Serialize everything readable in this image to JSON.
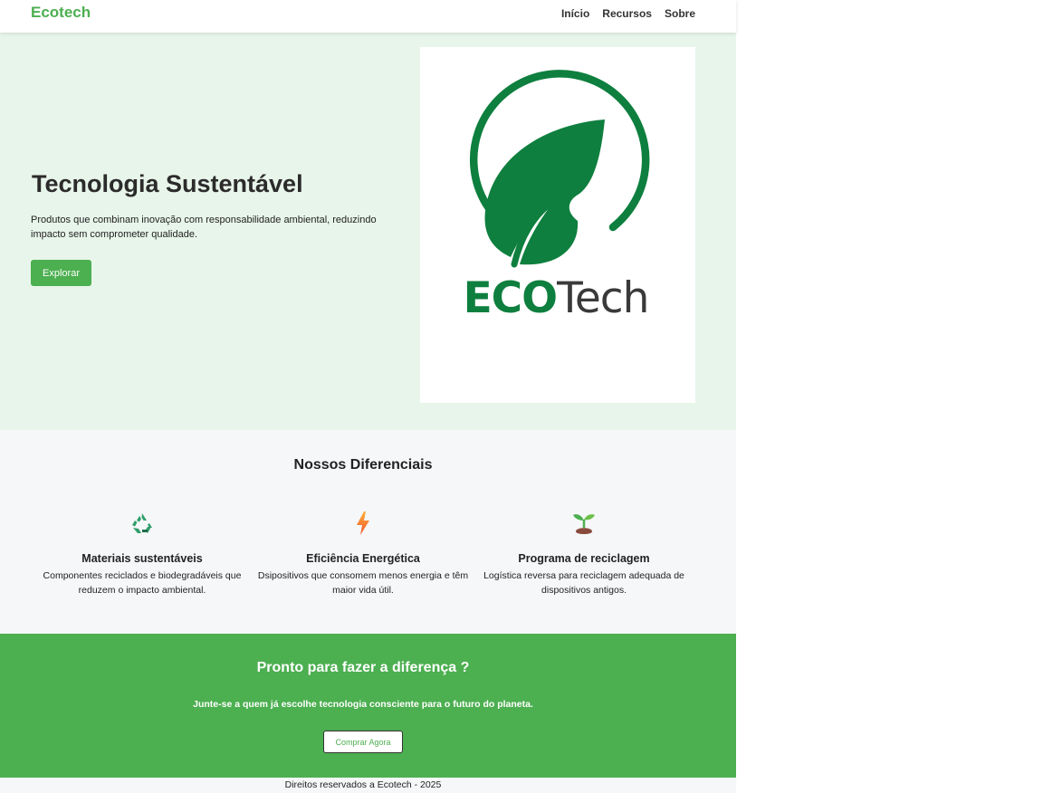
{
  "header": {
    "brand": "Ecotech",
    "nav": [
      "Início",
      "Recursos",
      "Sobre"
    ]
  },
  "hero": {
    "title": "Tecnologia Sustentável",
    "text": "Produtos que combinam inovação com responsabilidade ambiental, reduzindo impacto sem comprometer qualidade.",
    "button": "Explorar",
    "logo": {
      "eco": "ECO",
      "tech": "Tech",
      "icon": "leaf-circle-icon"
    }
  },
  "features": {
    "title": "Nossos Diferenciais",
    "items": [
      {
        "icon": "recycle-icon",
        "title": "Materiais sustentáveis",
        "text": "Componentes reciclados e biodegradáveis que reduzem o impacto ambiental."
      },
      {
        "icon": "lightning-icon",
        "title": "Eficiência Energética",
        "text": "Dsipositivos que consomem menos energia e têm maior vida útil."
      },
      {
        "icon": "seedling-icon",
        "title": "Programa de reciclagem",
        "text": "Logística reversa para reciclagem adequada de dispositivos antigos."
      }
    ]
  },
  "cta": {
    "title": "Pronto para fazer a diferença ?",
    "text": "Junte-se a quem já escolhe tecnologia consciente para o futuro do planeta.",
    "button": "Comprar Agora"
  },
  "footer": {
    "text": "Direitos reservados a Ecotech - 2025"
  },
  "colors": {
    "primary": "#4caf50",
    "hero_bg": "#e8f5ea",
    "logo_green": "#0e7f3e",
    "logo_gray": "#3a3a3a"
  }
}
